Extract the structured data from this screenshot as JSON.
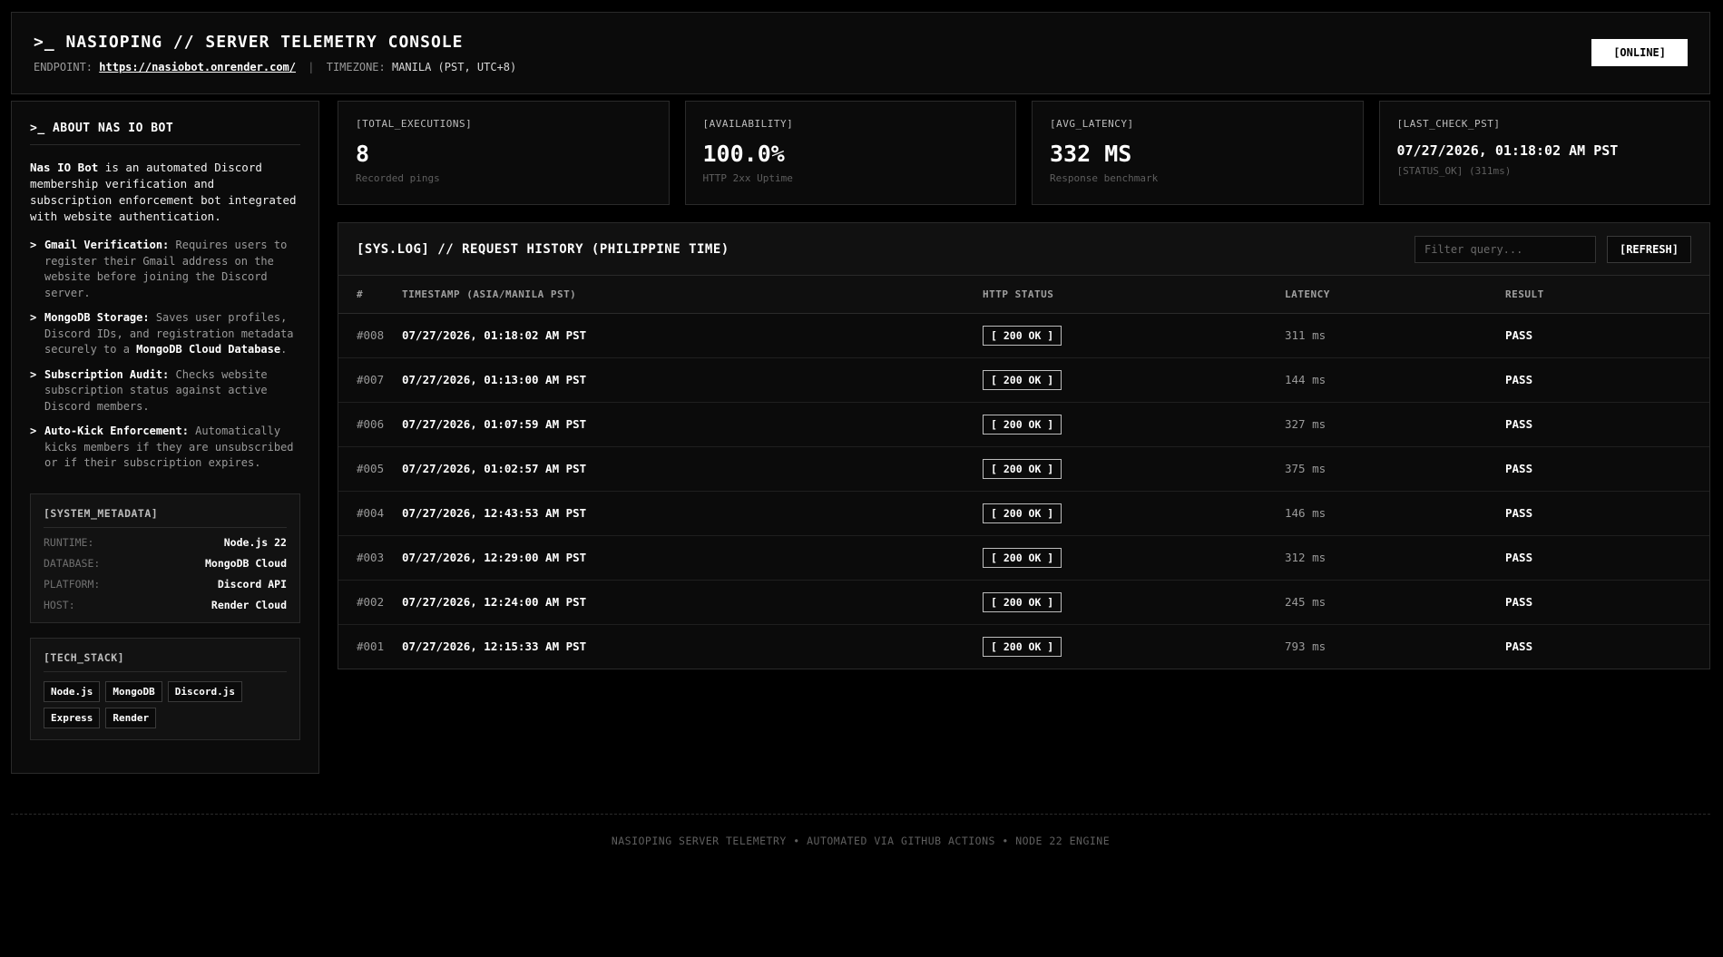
{
  "header": {
    "title": ">_ NASIOPING // SERVER TELEMETRY CONSOLE",
    "endpoint_label": "ENDPOINT:",
    "endpoint_url": "https://nasiobot.onrender.com/",
    "separator": "|",
    "timezone_label": "TIMEZONE:",
    "timezone_value": "MANILA (PST, UTC+8)",
    "status_badge": "[ONLINE]"
  },
  "sidebar": {
    "title": ">_ ABOUT NAS IO BOT",
    "intro_bold": "Nas IO Bot",
    "intro_rest": " is an automated Discord membership verification and subscription enforcement bot integrated with website authentication.",
    "bullet": ">",
    "features": [
      {
        "title": "Gmail Verification:",
        "text": " Requires users to register their Gmail address on the website before joining the Discord server."
      },
      {
        "title": "MongoDB Storage:",
        "text": " Saves user profiles, Discord IDs, and registration metadata securely to a ",
        "highlight": "MongoDB Cloud Database",
        "tail": "."
      },
      {
        "title": "Subscription Audit:",
        "text": " Checks website subscription status against active Discord members."
      },
      {
        "title": "Auto-Kick Enforcement:",
        "text": " Automatically kicks members if they are unsubscribed or if their subscription expires."
      }
    ],
    "metadata": {
      "title": "[SYSTEM_METADATA]",
      "rows": [
        {
          "key": "RUNTIME:",
          "value": "Node.js 22"
        },
        {
          "key": "DATABASE:",
          "value": "MongoDB Cloud"
        },
        {
          "key": "PLATFORM:",
          "value": "Discord API"
        },
        {
          "key": "HOST:",
          "value": "Render Cloud"
        }
      ]
    },
    "tech_stack": {
      "title": "[TECH_STACK]",
      "chips": [
        "Node.js",
        "MongoDB",
        "Discord.js",
        "Express",
        "Render"
      ]
    }
  },
  "stats": [
    {
      "label": "[TOTAL_EXECUTIONS]",
      "value": "8",
      "sub": "Recorded pings"
    },
    {
      "label": "[AVAILABILITY]",
      "value": "100.0%",
      "sub": "HTTP 2xx Uptime"
    },
    {
      "label": "[AVG_LATENCY]",
      "value": "332 MS",
      "sub": "Response benchmark"
    },
    {
      "label": "[LAST_CHECK_PST]",
      "value": "07/27/2026, 01:18:02 AM PST",
      "sub": "[STATUS_OK] (311ms)"
    }
  ],
  "log": {
    "title": "[SYS.LOG] // REQUEST HISTORY (PHILIPPINE TIME)",
    "filter_placeholder": "Filter query...",
    "filter_value": "",
    "refresh_label": "[REFRESH]",
    "columns": [
      "#",
      "TIMESTAMP (ASIA/MANILA PST)",
      "HTTP STATUS",
      "LATENCY",
      "RESULT"
    ],
    "rows": [
      {
        "id": "#008",
        "timestamp": "07/27/2026, 01:18:02 AM PST",
        "status": "[ 200 OK ]",
        "latency": "311 ms",
        "result": "PASS"
      },
      {
        "id": "#007",
        "timestamp": "07/27/2026, 01:13:00 AM PST",
        "status": "[ 200 OK ]",
        "latency": "144 ms",
        "result": "PASS"
      },
      {
        "id": "#006",
        "timestamp": "07/27/2026, 01:07:59 AM PST",
        "status": "[ 200 OK ]",
        "latency": "327 ms",
        "result": "PASS"
      },
      {
        "id": "#005",
        "timestamp": "07/27/2026, 01:02:57 AM PST",
        "status": "[ 200 OK ]",
        "latency": "375 ms",
        "result": "PASS"
      },
      {
        "id": "#004",
        "timestamp": "07/27/2026, 12:43:53 AM PST",
        "status": "[ 200 OK ]",
        "latency": "146 ms",
        "result": "PASS"
      },
      {
        "id": "#003",
        "timestamp": "07/27/2026, 12:29:00 AM PST",
        "status": "[ 200 OK ]",
        "latency": "312 ms",
        "result": "PASS"
      },
      {
        "id": "#002",
        "timestamp": "07/27/2026, 12:24:00 AM PST",
        "status": "[ 200 OK ]",
        "latency": "245 ms",
        "result": "PASS"
      },
      {
        "id": "#001",
        "timestamp": "07/27/2026, 12:15:33 AM PST",
        "status": "[ 200 OK ]",
        "latency": "793 ms",
        "result": "PASS"
      }
    ]
  },
  "footer": {
    "text": "NASIOPING SERVER TELEMETRY • AUTOMATED VIA GITHUB ACTIONS • NODE 22 ENGINE"
  }
}
